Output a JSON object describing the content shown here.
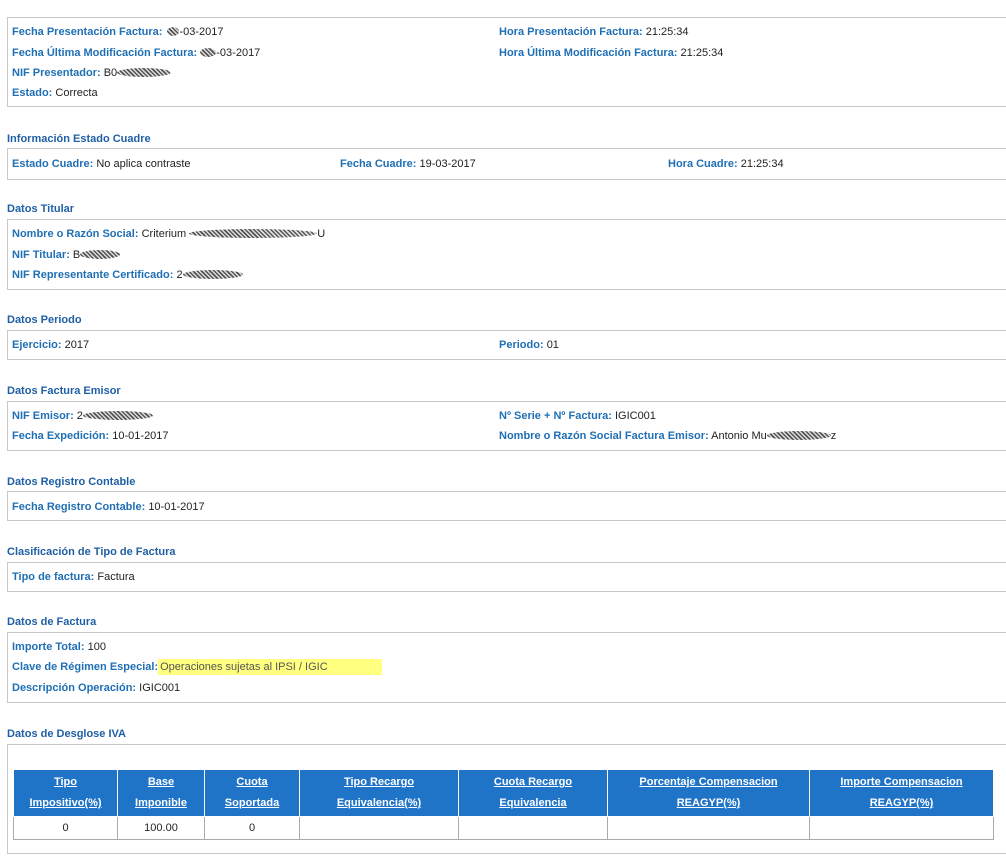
{
  "presentacion": {
    "fecha_label": "Fecha Presentación Factura:",
    "fecha_value": "-03-2017",
    "hora_label": "Hora Presentación Factura:",
    "hora_value": "21:25:34",
    "fecha_mod_label": "Fecha Última Modificación Factura:",
    "fecha_mod_value": "-03-2017",
    "hora_mod_label": "Hora Última Modificación Factura:",
    "hora_mod_value": "21:25:34",
    "nif_label": "NIF Presentador:",
    "nif_value": "B0",
    "estado_label": "Estado:",
    "estado_value": "Correcta"
  },
  "cuadre": {
    "title": "Información Estado Cuadre",
    "estado_label": "Estado Cuadre:",
    "estado_value": "No aplica contraste",
    "fecha_label": "Fecha Cuadre:",
    "fecha_value": "19-03-2017",
    "hora_label": "Hora Cuadre:",
    "hora_value": "21:25:34"
  },
  "titular": {
    "title": "Datos Titular",
    "nombre_label": "Nombre o Razón Social:",
    "nombre_value": "Criterium",
    "nombre_suffix": "U",
    "nif_label": "NIF Titular:",
    "nif_value": "B",
    "rep_label": "NIF Representante Certificado:",
    "rep_value": "2"
  },
  "periodo": {
    "title": "Datos Periodo",
    "ejercicio_label": "Ejercicio:",
    "ejercicio_value": "2017",
    "periodo_label": "Periodo:",
    "periodo_value": "01"
  },
  "emisor": {
    "title": "Datos Factura Emisor",
    "nif_label": "NIF Emisor:",
    "nif_value": "2",
    "serie_label": "Nº Serie + Nº Factura:",
    "serie_value": "IGIC001",
    "fecha_label": "Fecha Expedición:",
    "fecha_value": "10-01-2017",
    "nombre_label": "Nombre o Razón Social Factura Emisor:",
    "nombre_value": "Antonio Mu",
    "nombre_suffix": "z"
  },
  "registro": {
    "title": "Datos Registro Contable",
    "fecha_label": "Fecha Registro Contable:",
    "fecha_value": "10-01-2017"
  },
  "clasificacion": {
    "title": "Clasificación de Tipo de Factura",
    "tipo_label": "Tipo de factura:",
    "tipo_value": "Factura"
  },
  "factura": {
    "title": "Datos de Factura",
    "importe_label": "Importe Total:",
    "importe_value": "100",
    "clave_label": "Clave de Régimen Especial:",
    "clave_value": "Operaciones sujetas al IPSI / IGIC",
    "desc_label": "Descripción Operación:",
    "desc_value": "IGIC001"
  },
  "desglose": {
    "title": "Datos de Desglose IVA",
    "headers": [
      [
        "Tipo",
        "Impositivo(%)"
      ],
      [
        "Base",
        "Imponible"
      ],
      [
        "Cuota",
        "Soportada"
      ],
      [
        "Tipo Recargo",
        "Equivalencia(%)"
      ],
      [
        "Cuota Recargo",
        "Equivalencia"
      ],
      [
        "Porcentaje Compensacion",
        "REAGYP(%)"
      ],
      [
        "Importe Compensacion",
        "REAGYP(%)"
      ]
    ],
    "row": [
      "0",
      "100.00",
      "0",
      "",
      "",
      "",
      ""
    ]
  },
  "colors": {
    "label": "#1f6fb5",
    "title": "#1f5fa5",
    "table_header": "#1f74c8",
    "highlight": "#ffff80"
  }
}
